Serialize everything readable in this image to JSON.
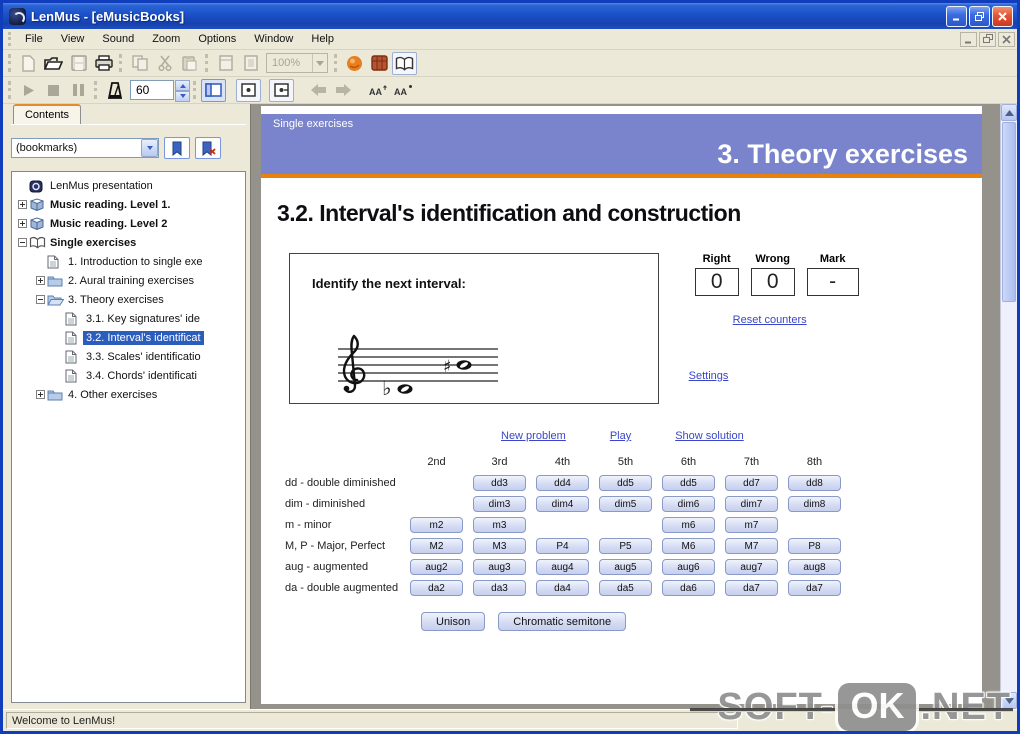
{
  "window": {
    "title": "LenMus - [eMusicBooks]"
  },
  "menu": {
    "items": [
      "File",
      "View",
      "Sound",
      "Zoom",
      "Options",
      "Window",
      "Help"
    ]
  },
  "toolbar": {
    "zoom_value": "100%",
    "tempo_value": "60",
    "icons_row1": [
      "new-document-icon",
      "open-folder-icon",
      "save-icon",
      "print-icon",
      "copy-icon",
      "cut-icon",
      "paste-icon",
      "page-setup-icon",
      "print-preview-icon",
      "midi-sound-icon",
      "instrument-icon",
      "music-book-icon"
    ],
    "icons_row2": [
      "play-icon",
      "stop-icon",
      "pause-icon",
      "metronome-icon",
      "toggle-sidebar-icon",
      "page-dot-icon",
      "page-dot-icon",
      "back-arrow-icon",
      "forward-arrow-icon",
      "font-increase-icon",
      "font-decrease-icon"
    ]
  },
  "sidebar": {
    "tab": "Contents",
    "bookmarks_value": "(bookmarks)",
    "tree": [
      {
        "label": "LenMus presentation",
        "icon": "presentation-book-icon",
        "level": 0,
        "bold": false,
        "expander": "none",
        "selected": false
      },
      {
        "label": "Music reading. Level 1.",
        "icon": "closed-book-icon",
        "level": 0,
        "bold": true,
        "expander": "plus",
        "selected": false
      },
      {
        "label": "Music reading. Level 2",
        "icon": "closed-book-icon",
        "level": 0,
        "bold": true,
        "expander": "plus",
        "selected": false
      },
      {
        "label": "Single exercises",
        "icon": "open-book-icon",
        "level": 0,
        "bold": true,
        "expander": "minus",
        "selected": false
      },
      {
        "label": "1. Introduction to single exe",
        "icon": "page-icon",
        "level": 1,
        "bold": false,
        "expander": "none",
        "selected": false
      },
      {
        "label": "2. Aural training exercises",
        "icon": "folder-icon",
        "level": 1,
        "bold": false,
        "expander": "plus",
        "selected": false
      },
      {
        "label": "3. Theory exercises",
        "icon": "folder-open-icon",
        "level": 1,
        "bold": false,
        "expander": "minus",
        "selected": false
      },
      {
        "label": "3.1. Key signatures' ide",
        "icon": "page-icon",
        "level": 2,
        "bold": false,
        "expander": "none",
        "selected": false
      },
      {
        "label": "3.2. Interval's identificat",
        "icon": "page-icon",
        "level": 2,
        "bold": false,
        "expander": "none",
        "selected": true
      },
      {
        "label": "3.3. Scales' identificatio",
        "icon": "page-icon",
        "level": 2,
        "bold": false,
        "expander": "none",
        "selected": false
      },
      {
        "label": "3.4. Chords' identificati",
        "icon": "page-icon",
        "level": 2,
        "bold": false,
        "expander": "none",
        "selected": false
      },
      {
        "label": "4. Other exercises",
        "icon": "folder-icon",
        "level": 1,
        "bold": false,
        "expander": "plus",
        "selected": false
      }
    ]
  },
  "content": {
    "breadcrumb": "Single exercises",
    "banner_title": "3. Theory exercises",
    "heading": "3.2. Interval's identification and construction",
    "banner_color": "#7a84cc",
    "rule_color": "#e8820c",
    "exercise": {
      "prompt": "Identify the next interval:",
      "accidental_flat": "♭",
      "accidental_sharp": "♯",
      "counters": {
        "right_label": "Right",
        "wrong_label": "Wrong",
        "mark_label": "Mark",
        "right_value": "0",
        "wrong_value": "0",
        "mark_value": "-"
      },
      "reset_link": "Reset counters",
      "settings_link": "Settings",
      "new_problem_link": "New problem",
      "play_link": "Play",
      "show_solution_link": "Show solution"
    },
    "intervals": {
      "columns": [
        "2nd",
        "3rd",
        "4th",
        "5th",
        "6th",
        "7th",
        "8th"
      ],
      "rows": [
        {
          "label": "dd - double diminished",
          "buttons": [
            {
              "col": 1,
              "label": "dd3"
            },
            {
              "col": 2,
              "label": "dd4"
            },
            {
              "col": 3,
              "label": "dd5"
            },
            {
              "col": 4,
              "label": "dd5"
            },
            {
              "col": 5,
              "label": "dd7"
            },
            {
              "col": 6,
              "label": "dd8"
            }
          ]
        },
        {
          "label": "dim - diminished",
          "buttons": [
            {
              "col": 1,
              "label": "dim3"
            },
            {
              "col": 2,
              "label": "dim4"
            },
            {
              "col": 3,
              "label": "dim5"
            },
            {
              "col": 4,
              "label": "dim6"
            },
            {
              "col": 5,
              "label": "dim7"
            },
            {
              "col": 6,
              "label": "dim8"
            }
          ]
        },
        {
          "label": "m - minor",
          "buttons": [
            {
              "col": 0,
              "label": "m2"
            },
            {
              "col": 1,
              "label": "m3"
            },
            {
              "col": 4,
              "label": "m6"
            },
            {
              "col": 5,
              "label": "m7"
            }
          ]
        },
        {
          "label": "M, P - Major, Perfect",
          "buttons": [
            {
              "col": 0,
              "label": "M2"
            },
            {
              "col": 1,
              "label": "M3"
            },
            {
              "col": 2,
              "label": "P4"
            },
            {
              "col": 3,
              "label": "P5"
            },
            {
              "col": 4,
              "label": "M6"
            },
            {
              "col": 5,
              "label": "M7"
            },
            {
              "col": 6,
              "label": "P8"
            }
          ]
        },
        {
          "label": "aug - augmented",
          "buttons": [
            {
              "col": 0,
              "label": "aug2"
            },
            {
              "col": 1,
              "label": "aug3"
            },
            {
              "col": 2,
              "label": "aug4"
            },
            {
              "col": 3,
              "label": "aug5"
            },
            {
              "col": 4,
              "label": "aug6"
            },
            {
              "col": 5,
              "label": "aug7"
            },
            {
              "col": 6,
              "label": "aug8"
            }
          ]
        },
        {
          "label": "da - double augmented",
          "buttons": [
            {
              "col": 0,
              "label": "da2"
            },
            {
              "col": 1,
              "label": "da3"
            },
            {
              "col": 2,
              "label": "da4"
            },
            {
              "col": 3,
              "label": "da5"
            },
            {
              "col": 4,
              "label": "da6"
            },
            {
              "col": 5,
              "label": "da7"
            },
            {
              "col": 6,
              "label": "da7"
            }
          ]
        }
      ],
      "special": [
        "Unison",
        "Chromatic semitone"
      ]
    }
  },
  "statusbar": {
    "text": "Welcome to LenMus!"
  },
  "watermark": {
    "part1": "SOFT-",
    "part2": "OK",
    "part3": ".NET"
  }
}
